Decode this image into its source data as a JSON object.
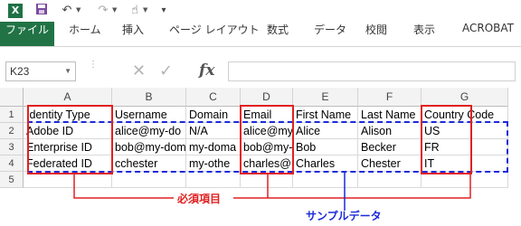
{
  "quick_access": {
    "app_icon": "X",
    "icons": [
      "excel-icon",
      "save-icon",
      "undo-icon",
      "redo-icon",
      "touch-mode-icon",
      "customize-icon"
    ]
  },
  "ribbon": {
    "tabs": [
      "ファイル",
      "ホーム",
      "挿入",
      "ページ レイアウト",
      "数式",
      "データ",
      "校閲",
      "表示",
      "ACROBAT"
    ],
    "file_tab_color": "#217346"
  },
  "formula_bar": {
    "name_box": "K23",
    "formula": "",
    "fx_label": "fx"
  },
  "sheet": {
    "columns": [
      "A",
      "B",
      "C",
      "D",
      "E",
      "F",
      "G"
    ],
    "rows": [
      "1",
      "2",
      "3",
      "4",
      "5"
    ],
    "cells": [
      [
        "Identity Type",
        "Username",
        "Domain",
        "Email",
        "First Name",
        "Last Name",
        "Country Code"
      ],
      [
        "Adobe ID",
        "alice@my-do",
        "N/A",
        "alice@my",
        "Alice",
        "Alison",
        "US"
      ],
      [
        "Enterprise ID",
        "bob@my-dom",
        "my-doma",
        "bob@my-",
        "Bob",
        "Becker",
        "FR"
      ],
      [
        "Federated ID",
        "cchester",
        "my-othe",
        "charles@",
        "Charles",
        "Chester",
        "IT"
      ]
    ]
  },
  "annotations": {
    "required_label": "必須項目",
    "sample_label": "サンプルデータ",
    "required_color": "#e02020",
    "sample_color": "#1b2bd8"
  }
}
